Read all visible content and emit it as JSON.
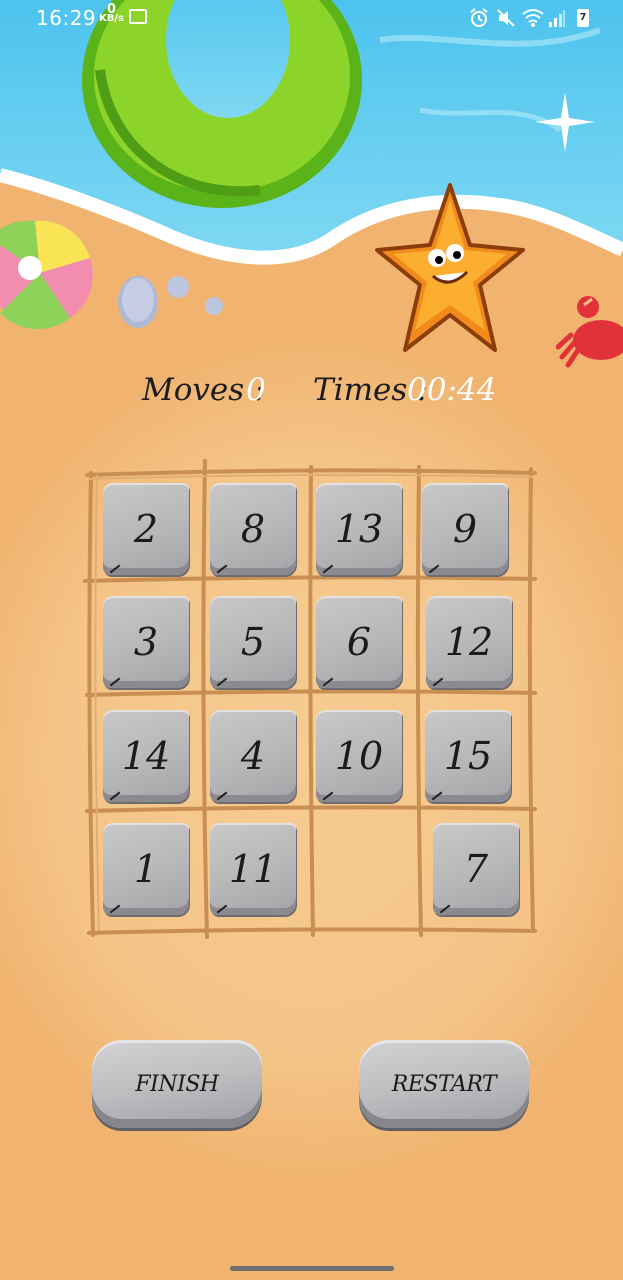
{
  "status_bar": {
    "time": "16:29",
    "net_speed_value": "0",
    "net_speed_unit": "KB/s",
    "battery": "7"
  },
  "hud": {
    "moves_label": "Moves :",
    "moves_value": "0",
    "times_label": "Times :",
    "times_value": "00:44"
  },
  "board": {
    "rows": [
      [
        "2",
        "8",
        "13",
        "9"
      ],
      [
        "3",
        "5",
        "6",
        "12"
      ],
      [
        "14",
        "4",
        "10",
        "15"
      ],
      [
        "1",
        "11",
        "",
        "7"
      ]
    ]
  },
  "buttons": {
    "finish": "FINISH",
    "restart": "RESTART"
  },
  "icons": [
    "swim-ring-icon",
    "beach-ball-icon",
    "pebble-icon",
    "starfish-icon",
    "crab-icon",
    "sparkle-icon"
  ],
  "colors": {
    "sea": "#53c7ec",
    "sand": "#f3bf7c",
    "value_text": "#ffffff"
  }
}
